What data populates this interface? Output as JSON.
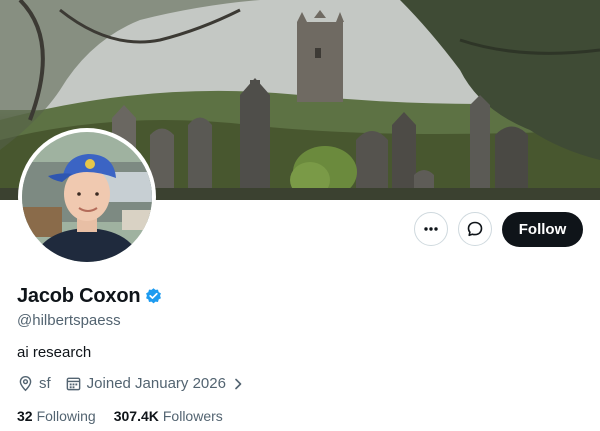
{
  "profile": {
    "display_name": "Jacob Coxon",
    "handle": "@hilbertspaess",
    "bio": "ai research",
    "location": "sf",
    "joined": "Joined January 2026",
    "verified": true
  },
  "actions": {
    "more_icon": "more-horizontal-icon",
    "message_icon": "message-bubble-icon",
    "follow_label": "Follow"
  },
  "stats": {
    "following_count": "32",
    "following_label": "Following",
    "followers_count": "307.4K",
    "followers_label": "Followers"
  },
  "colors": {
    "verified_blue": "#1d9bf0",
    "follow_bg": "#0f1419",
    "secondary_text": "#536471"
  }
}
